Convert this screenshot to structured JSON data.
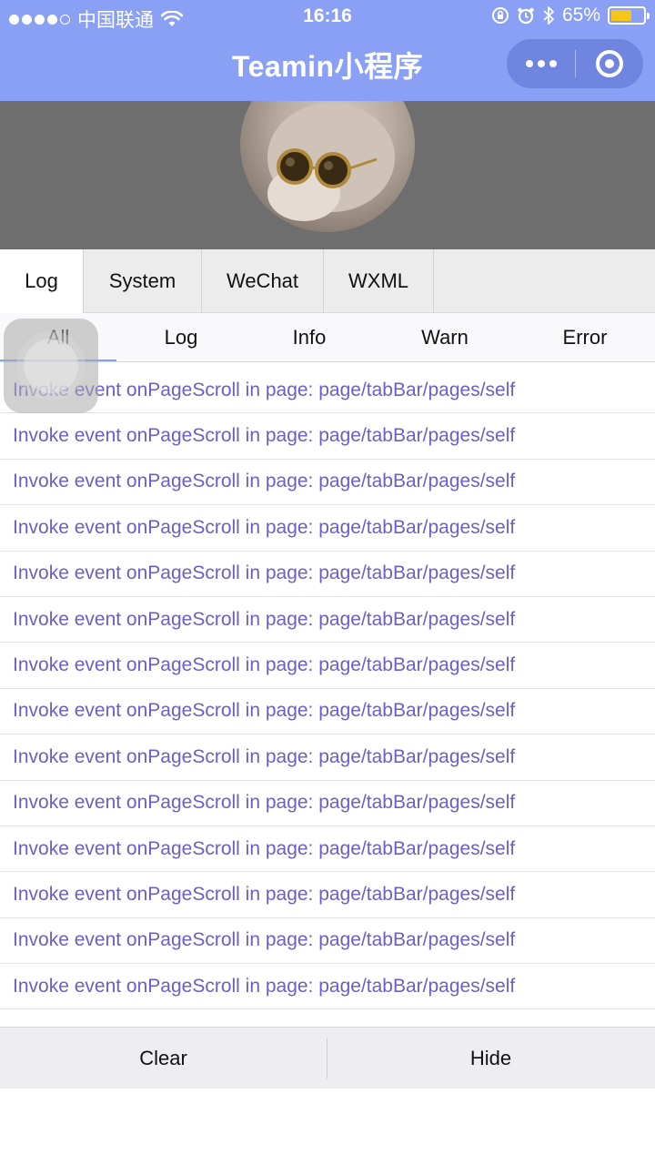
{
  "status_bar": {
    "carrier": "中国联通",
    "time": "16:16",
    "battery_percent": "65%",
    "battery_level": 0.65,
    "icons": [
      "signal-dots-icon",
      "wifi-icon",
      "rotation-lock-icon",
      "alarm-icon",
      "bluetooth-icon",
      "battery-icon"
    ]
  },
  "header": {
    "title": "Teamin小程序"
  },
  "colors": {
    "nav_bg": "#8aa0f5",
    "log_text": "#6a5fc9",
    "active_underline": "#7ba3f0",
    "battery_fill": "#f5c518"
  },
  "console": {
    "tabs": [
      {
        "label": "Log",
        "active": true
      },
      {
        "label": "System",
        "active": false
      },
      {
        "label": "WeChat",
        "active": false
      },
      {
        "label": "WXML",
        "active": false
      }
    ],
    "subtabs": [
      {
        "label": "All",
        "active": true
      },
      {
        "label": "Log",
        "active": false
      },
      {
        "label": "Info",
        "active": false
      },
      {
        "label": "Warn",
        "active": false
      },
      {
        "label": "Error",
        "active": false
      }
    ],
    "logs": [
      "Invoke event onPageScroll in page: page/tabBar/pages/self",
      "Invoke event onPageScroll in page: page/tabBar/pages/self",
      "Invoke event onPageScroll in page: page/tabBar/pages/self",
      "Invoke event onPageScroll in page: page/tabBar/pages/self",
      "Invoke event onPageScroll in page: page/tabBar/pages/self",
      "Invoke event onPageScroll in page: page/tabBar/pages/self",
      "Invoke event onPageScroll in page: page/tabBar/pages/self",
      "Invoke event onPageScroll in page: page/tabBar/pages/self",
      "Invoke event onPageScroll in page: page/tabBar/pages/self",
      "Invoke event onPageScroll in page: page/tabBar/pages/self",
      "Invoke event onPageScroll in page: page/tabBar/pages/self",
      "Invoke event onPageScroll in page: page/tabBar/pages/self",
      "Invoke event onPageScroll in page: page/tabBar/pages/self",
      "Invoke event onPageScroll in page: page/tabBar/pages/self"
    ],
    "footer": {
      "clear_label": "Clear",
      "hide_label": "Hide"
    }
  }
}
